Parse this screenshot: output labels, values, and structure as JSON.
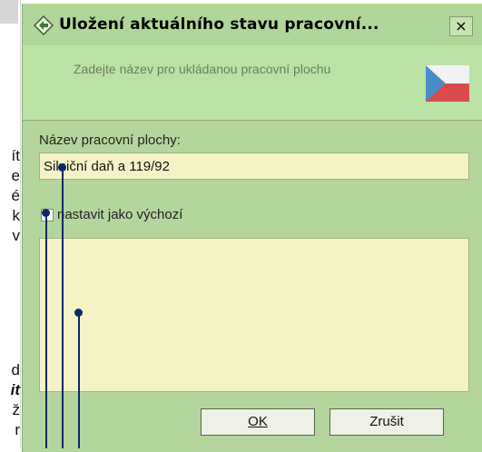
{
  "background_doc": {
    "lines": [
      "ít",
      "e",
      "é",
      "k",
      "v",
      "d",
      "it",
      "ž",
      "r"
    ]
  },
  "dialog": {
    "title": "Uložení aktuálního stavu pracovní...",
    "close_label": "×",
    "header_text": "Zadejte název pro ukládanou pracovní plochu",
    "field_label": "Název pracovní plochy:",
    "name_value": "Silniční daň a 119/92",
    "checkbox_label": "nastavit jako výchozí",
    "ok_label": "OK",
    "cancel_label": "Zrušit"
  },
  "colors": {
    "dialog_bg": "#b4d69c",
    "input_bg": "#f5f3c6",
    "callout": "#0a2a66"
  }
}
